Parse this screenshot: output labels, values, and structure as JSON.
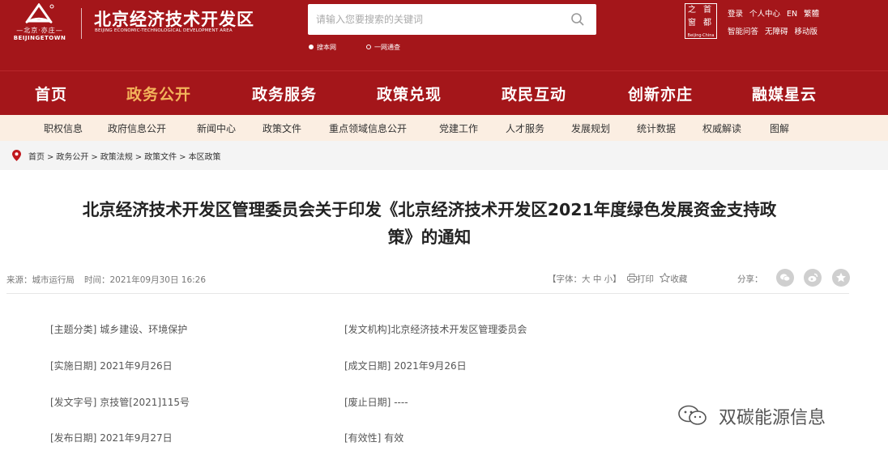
{
  "header": {
    "logo": {
      "line": "—北京·亦庄—",
      "en": "BEIJINGETOWN"
    },
    "site_title": "北京经济技术开发区",
    "site_subtitle": "BEIJING ECONOMIC-TECHNOLOGICAL DEVELOPMENT AREA",
    "search": {
      "placeholder": "请输入您要搜索的关键词",
      "scope_options": [
        {
          "label": "搜本网",
          "selected": true
        },
        {
          "label": "一网通查",
          "selected": false
        }
      ]
    },
    "capital_logo": {
      "glyphs": [
        "之",
        "首",
        "窗",
        "都"
      ],
      "label": "Beijing·China"
    },
    "links_row1": [
      "登录",
      "个人中心",
      "EN",
      "繁體"
    ],
    "links_row2": [
      "智能问答",
      "无障碍",
      "移动版"
    ]
  },
  "main_nav": {
    "items": [
      "首页",
      "政务公开",
      "政务服务",
      "政策兑现",
      "政民互动",
      "创新亦庄",
      "融媒星云"
    ],
    "active_index": 1
  },
  "sub_nav": {
    "items": [
      "职权信息",
      "政府信息公开",
      "新闻中心",
      "政策文件",
      "重点领域信息公开",
      "党建工作",
      "人才服务",
      "发展规划",
      "统计数据",
      "权威解读",
      "图解"
    ]
  },
  "breadcrumb": [
    "首页",
    "政务公开",
    "政策法规",
    "政策文件",
    "本区政策"
  ],
  "breadcrumb_sep": ">",
  "article": {
    "title_line1": "北京经济技术开发区管理委员会关于印发《北京经济技术开发区2021年度绿色发展资金支持政",
    "title_line2": "策》的通知",
    "source": "来源：城市运行局",
    "time": "时间：2021年09月30日 16:26",
    "font_size_label": "【字体：大 中 小】",
    "print_label": "打印",
    "favorite_label": "收藏",
    "share_label": "分享：",
    "share_icons": [
      "wechat-icon",
      "weibo-icon",
      "star-share-icon"
    ],
    "fields": [
      {
        "label": "[主题分类]",
        "value": "城乡建设、环境保护"
      },
      {
        "label": "[发文机构]",
        "value": "北京经济技术开发区管理委员会"
      },
      {
        "label": "[实施日期]",
        "value": "2021年9月26日"
      },
      {
        "label": "[成文日期]",
        "value": "2021年9月26日"
      },
      {
        "label": "[发文字号]",
        "value": "京技管[2021]115号"
      },
      {
        "label": "[废止日期]",
        "value": "----"
      },
      {
        "label": "[发布日期]",
        "value": "2021年9月27日"
      },
      {
        "label": "[有效性]",
        "value": "有效"
      }
    ]
  },
  "watermark": {
    "text": "双碳能源信息",
    "icon": "wechat-icon"
  },
  "colors": {
    "brand_red": "#a4161a",
    "active_nav": "#f3b45b",
    "subnav_bg": "#fbeee2",
    "crumb_bg": "#f4f4f4"
  }
}
